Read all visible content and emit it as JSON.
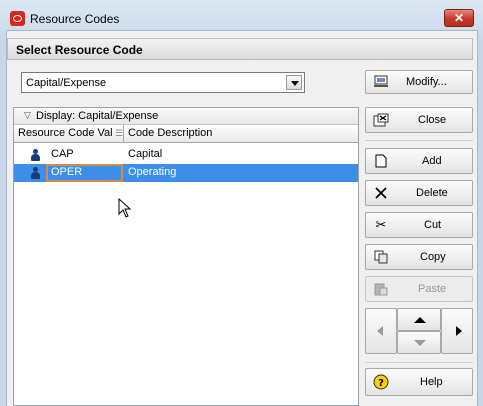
{
  "window": {
    "title": "Resource Codes",
    "close_icon": "close-x-icon"
  },
  "section": {
    "title": "Select Resource Code"
  },
  "combo": {
    "value": "Capital/Expense"
  },
  "buttons": {
    "modify": "Modify...",
    "close": "Close",
    "add": "Add",
    "delete": "Delete",
    "cut": "Cut",
    "copy": "Copy",
    "paste": "Paste",
    "help": "Help"
  },
  "grid": {
    "group_label": "Display: Capital/Expense",
    "columns": [
      "Resource Code Val",
      "Code Description"
    ],
    "rows": [
      {
        "code": "CAP",
        "description": "Capital",
        "selected": false
      },
      {
        "code": "OPER",
        "description": "Operating",
        "selected": true
      }
    ]
  },
  "colors": {
    "selection": "#3d8ee8",
    "title_close": "#c6392a"
  }
}
